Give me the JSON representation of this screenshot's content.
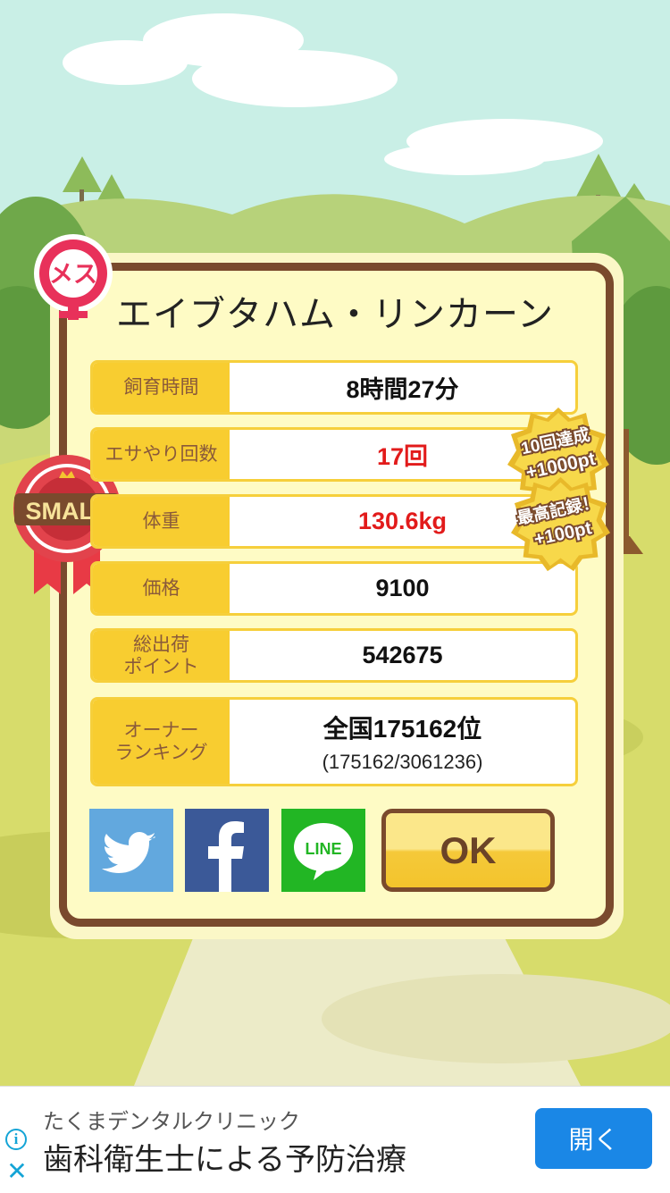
{
  "pet": {
    "name": "エイブタハム・リンカーン",
    "gender_label": "メス",
    "size_badge": "SMALL"
  },
  "stats": [
    {
      "label": "飼育時間",
      "value": "8時間27分",
      "highlight": false
    },
    {
      "label": "エサやり回数",
      "value": "17回",
      "highlight": true
    },
    {
      "label": "体重",
      "value": "130.6kg",
      "highlight": true
    },
    {
      "label": "価格",
      "value": "9100",
      "highlight": false
    },
    {
      "label": "総出荷\nポイント",
      "value": "542675",
      "highlight": false
    }
  ],
  "ranking": {
    "label": "オーナー\nランキング",
    "value": "全国175162位",
    "detail": "(175162/3061236)"
  },
  "bonus_badges": {
    "feed": {
      "line1": "10回達成",
      "line2": "+1000pt"
    },
    "weight": {
      "line1": "最高記録！",
      "line2": "+100pt"
    }
  },
  "share": {
    "twitter_icon": "twitter-icon",
    "facebook_icon": "facebook-icon",
    "line_label": "LINE",
    "ok_label": "OK"
  },
  "ad": {
    "advertiser": "たくまデンタルクリニック",
    "headline": "歯科衛生士による予防治療",
    "button_label": "開く"
  },
  "colors": {
    "sky": "#c9efe6",
    "card_border": "#7a4a2d",
    "label_bg": "#f8cd30",
    "highlight": "#e21b1b",
    "twitter": "#62a8de",
    "facebook": "#3b5998",
    "line": "#22b624",
    "ad_button": "#1a87e6"
  }
}
